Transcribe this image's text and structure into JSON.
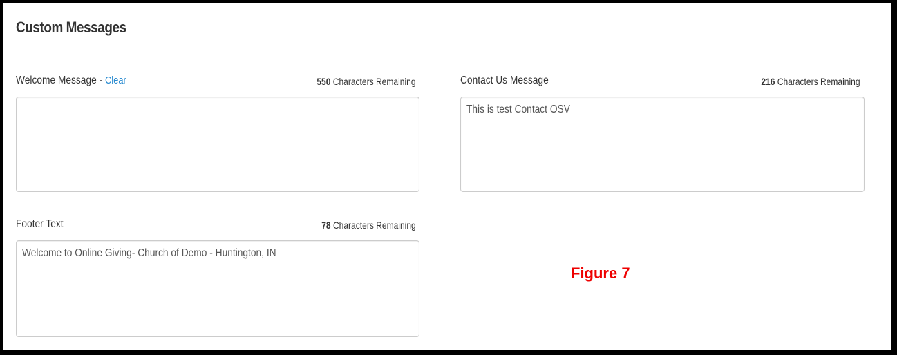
{
  "panel": {
    "title": "Custom Messages"
  },
  "welcome": {
    "label": "Welcome Message - ",
    "clear_link": "Clear",
    "remaining_count": "550",
    "remaining_label": " Characters Remaining",
    "value": ""
  },
  "contact": {
    "label": "Contact Us Message",
    "remaining_count": "216",
    "remaining_label": " Characters Remaining",
    "value": "This is test Contact OSV"
  },
  "footer": {
    "label": "Footer Text",
    "remaining_count": "78",
    "remaining_label": " Characters Remaining",
    "value": "Welcome to Online Giving- Church of Demo - Huntington, IN"
  },
  "caption": "Figure 7",
  "colors": {
    "link": "#2a8bd0",
    "caption": "#ee0000",
    "frame_border": "#000000"
  }
}
